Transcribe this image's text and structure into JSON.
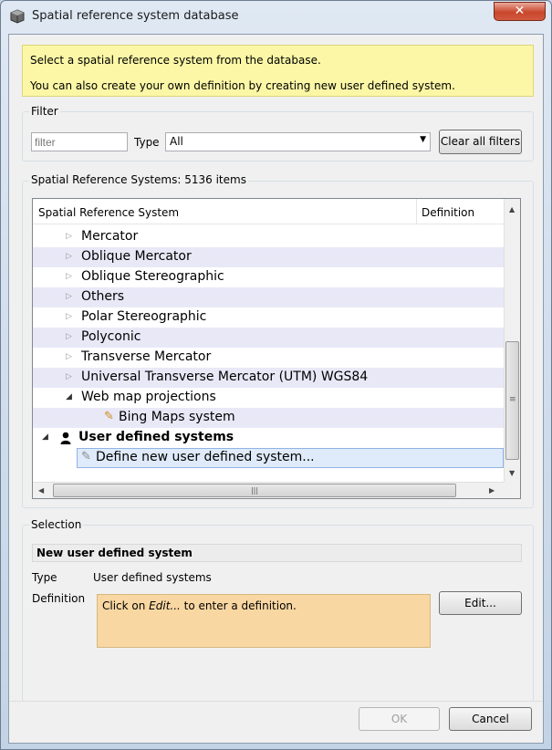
{
  "window": {
    "title": "Spatial reference system database",
    "close_label": "✕"
  },
  "info": {
    "line1": "Select a spatial reference system from the database.",
    "line2": "You can also create your own definition by creating new user defined system."
  },
  "filter": {
    "group_title": "Filter",
    "placeholder": "filter",
    "type_label": "Type",
    "type_value": "All",
    "clear_button": "Clear all filters"
  },
  "systems": {
    "group_title": "Spatial Reference Systems: 5136 items",
    "columns": [
      "Spatial Reference System",
      "Definition"
    ],
    "rows": [
      {
        "label": "Mercator",
        "level": 1,
        "expanded": false,
        "alt": false
      },
      {
        "label": "Oblique Mercator",
        "level": 1,
        "expanded": false,
        "alt": true
      },
      {
        "label": "Oblique Stereographic",
        "level": 1,
        "expanded": false,
        "alt": false
      },
      {
        "label": "Others",
        "level": 1,
        "expanded": false,
        "alt": true
      },
      {
        "label": "Polar Stereographic",
        "level": 1,
        "expanded": false,
        "alt": false
      },
      {
        "label": "Polyconic",
        "level": 1,
        "expanded": false,
        "alt": true
      },
      {
        "label": "Transverse Mercator",
        "level": 1,
        "expanded": false,
        "alt": false
      },
      {
        "label": "Universal Transverse Mercator (UTM) WGS84",
        "level": 1,
        "expanded": false,
        "alt": true
      },
      {
        "label": "Web map projections",
        "level": 1,
        "expanded": true,
        "alt": false
      },
      {
        "label": "Bing Maps system",
        "level": 2,
        "alt": true
      },
      {
        "label": "User defined systems",
        "level": 0,
        "expanded": true,
        "alt": false
      },
      {
        "label": "Define new user defined system...",
        "level": 1,
        "alt": false,
        "selected": true
      }
    ]
  },
  "selection": {
    "group_title": "Selection",
    "name": "New user defined system",
    "type_label": "Type",
    "type_value": "User defined systems",
    "definition_label": "Definition",
    "definition_prefix": "Click on ",
    "definition_link": "Edit...",
    "definition_suffix": " to enter a definition.",
    "edit_button": "Edit..."
  },
  "buttons": {
    "ok": "OK",
    "cancel": "Cancel"
  },
  "colors": {
    "info_bg": "#fbf7a6",
    "definition_bg": "#f9d7a2",
    "alt_row": "#e8e8f7",
    "close_red": "#c9462c"
  }
}
